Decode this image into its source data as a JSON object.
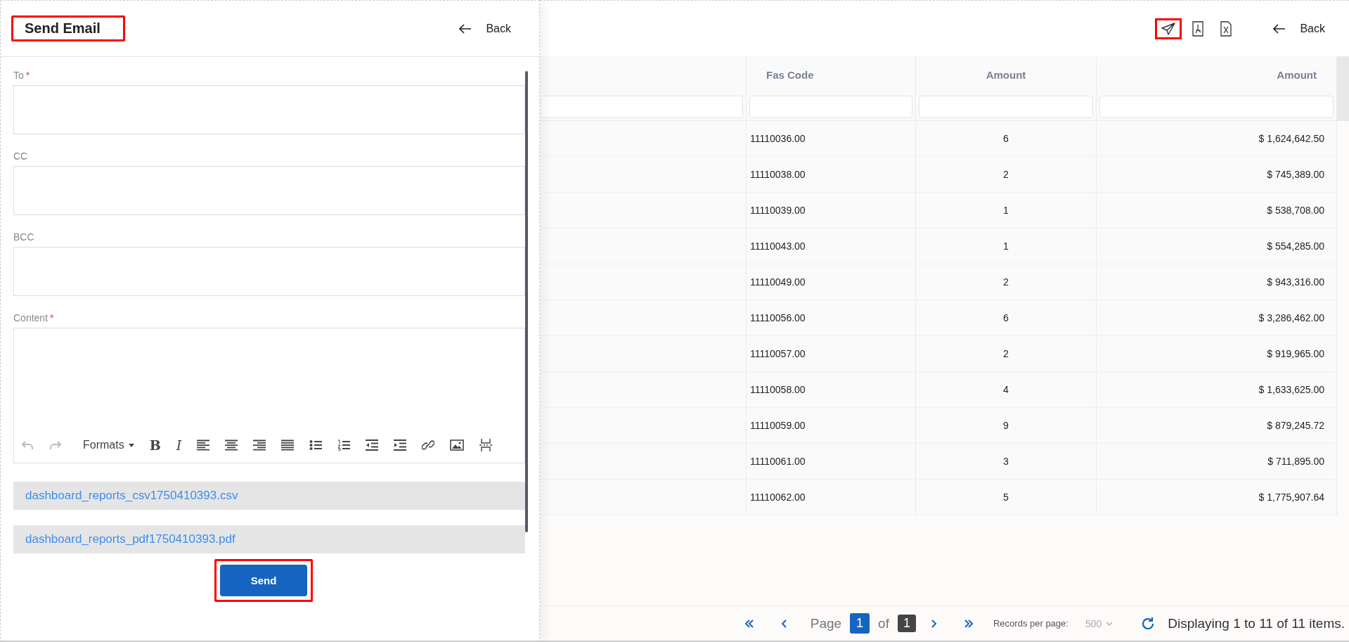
{
  "email_panel": {
    "title": "Send Email",
    "title_highlighted": true,
    "back": "Back",
    "required_mark": "*",
    "fields": [
      {
        "label": "To",
        "required": true,
        "kind": "input"
      },
      {
        "label": "CC",
        "required": false,
        "kind": "input"
      },
      {
        "label": "BCC",
        "required": false,
        "kind": "input"
      },
      {
        "label": "Content",
        "required": true,
        "kind": "editor"
      }
    ],
    "toolbar": [
      {
        "kind": "undo",
        "disabled": true
      },
      {
        "kind": "redo",
        "disabled": true
      },
      {
        "kind": "formats",
        "label": "Formats",
        "disabled": false
      },
      {
        "kind": "bold",
        "label": "B",
        "disabled": false
      },
      {
        "kind": "italic",
        "label": "I",
        "disabled": false
      },
      {
        "kind": "align-left",
        "disabled": false
      },
      {
        "kind": "align-center",
        "disabled": false
      },
      {
        "kind": "align-right",
        "disabled": false
      },
      {
        "kind": "justify",
        "disabled": false
      },
      {
        "kind": "bullets",
        "disabled": false
      },
      {
        "kind": "numbers",
        "disabled": false
      },
      {
        "kind": "outdent",
        "disabled": false
      },
      {
        "kind": "indent",
        "disabled": false
      },
      {
        "kind": "link",
        "disabled": false
      },
      {
        "kind": "image",
        "disabled": false
      },
      {
        "kind": "page-break",
        "disabled": false
      }
    ],
    "attachments": [
      "dashboard_reports_csv1750410393.csv",
      "dashboard_reports_pdf1750410393.pdf"
    ],
    "send_button": {
      "label": "Send",
      "highlighted": true
    }
  },
  "report": {
    "actions": [
      {
        "kind": "send",
        "highlighted": true
      },
      {
        "kind": "pdf",
        "highlighted": false
      },
      {
        "kind": "excel",
        "highlighted": false
      }
    ],
    "back": "Back",
    "table": {
      "columns": [
        "Fas Code",
        "Amount",
        "Amount"
      ],
      "rows": [
        [
          "11110036.00",
          "6",
          "$ 1,624,642.50"
        ],
        [
          "11110038.00",
          "2",
          "$ 745,389.00"
        ],
        [
          "11110039.00",
          "1",
          "$ 538,708.00"
        ],
        [
          "11110043.00",
          "1",
          "$ 554,285.00"
        ],
        [
          "11110049.00",
          "2",
          "$ 943,316.00"
        ],
        [
          "11110056.00",
          "6",
          "$ 3,286,462.00"
        ],
        [
          "11110057.00",
          "2",
          "$ 919,965.00"
        ],
        [
          "11110058.00",
          "4",
          "$ 1,633,625.00"
        ],
        [
          "11110059.00",
          "9",
          "$ 879,245.72"
        ],
        [
          "11110061.00",
          "3",
          "$ 711,895.00"
        ],
        [
          "11110062.00",
          "5",
          "$ 1,775,907.64"
        ]
      ]
    },
    "pagination": {
      "page_label": "Page",
      "current_page": "1",
      "of_label": "of",
      "total_pages": "1",
      "records_label": "Records per page:",
      "records_value": "500",
      "records_disabled": true,
      "summary": "Displaying 1 to 11 of 11 items."
    }
  }
}
